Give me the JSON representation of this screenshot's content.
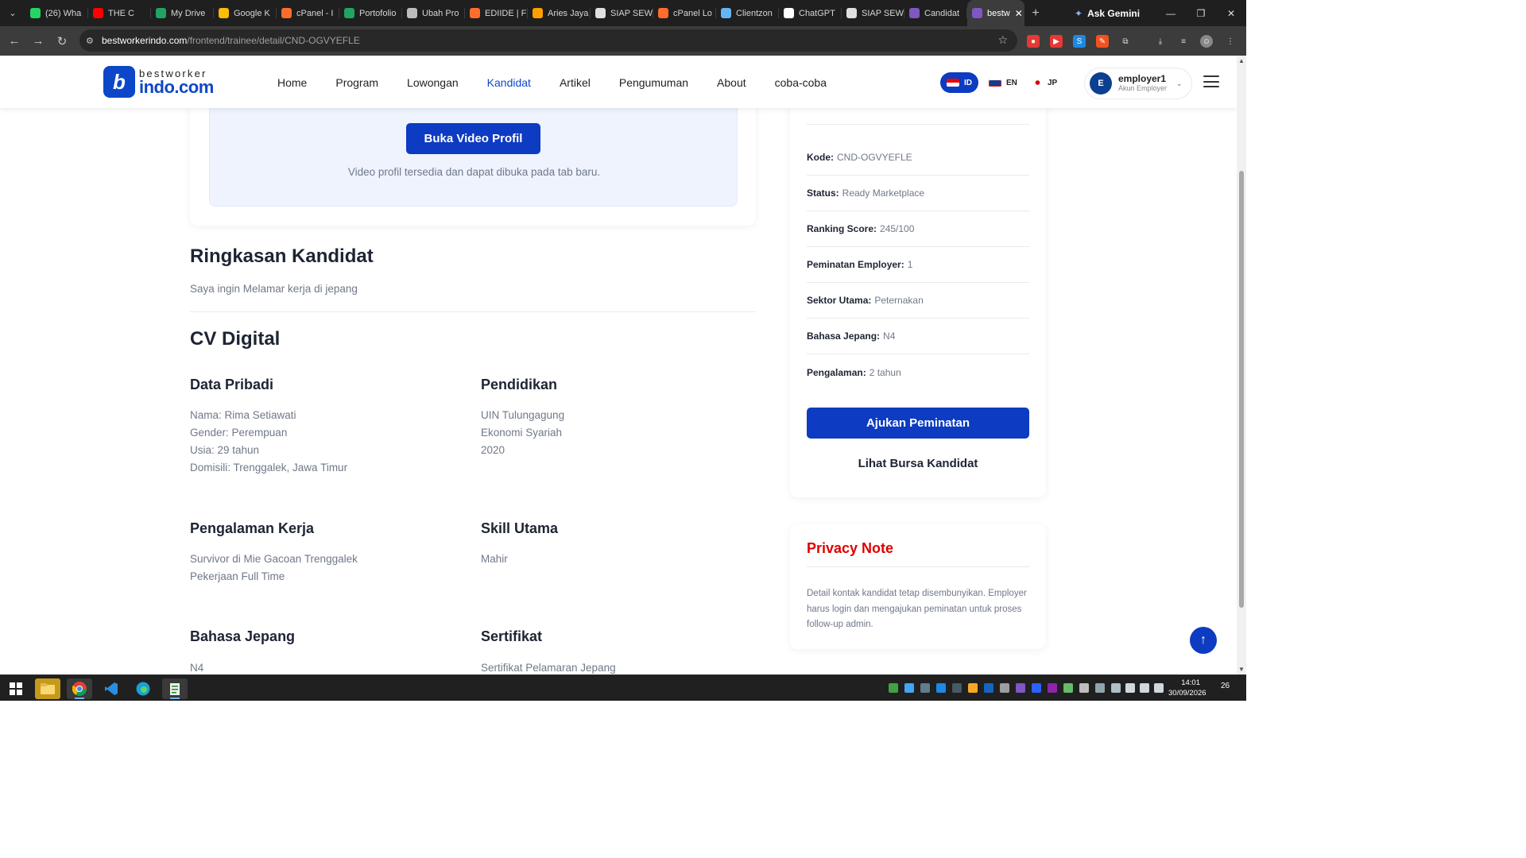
{
  "browser": {
    "tabs": [
      {
        "label": "(26) Wha",
        "color": "#25d366",
        "badge": "26"
      },
      {
        "label": "THE C",
        "color": "#ff0000"
      },
      {
        "label": "My Drive",
        "color": "#1fa463"
      },
      {
        "label": "Google K",
        "color": "#fbbc04"
      },
      {
        "label": "cPanel - I",
        "color": "#ff6c2c"
      },
      {
        "label": "Portofolio",
        "color": "#1fa463"
      },
      {
        "label": "Ubah Pro",
        "color": "#bdbdbd"
      },
      {
        "label": "EDIIDE | F",
        "color": "#ff6c2c"
      },
      {
        "label": "Aries Jaya",
        "color": "#ffa000"
      },
      {
        "label": "SIAP SEW",
        "color": "#e0e0e0"
      },
      {
        "label": "cPanel Lo",
        "color": "#ff6c2c"
      },
      {
        "label": "Clientzon",
        "color": "#64b5f6"
      },
      {
        "label": "ChatGPT",
        "color": "#ffffff"
      },
      {
        "label": "SIAP SEW",
        "color": "#e0e0e0"
      },
      {
        "label": "Candidat",
        "color": "#7e57c2"
      }
    ],
    "active_tab": {
      "label": "bestw",
      "color": "#7e57c2"
    },
    "gemini_label": "Ask Gemini",
    "url_host": "bestworkerindo.com",
    "url_path": "/frontend/trainee/detail/CND-OGVYEFLE"
  },
  "site": {
    "logo_line1": "bestworker",
    "logo_line2": "indo.com",
    "logo_mark": "b",
    "menu": [
      "Home",
      "Program",
      "Lowongan",
      "Kandidat",
      "Artikel",
      "Pengumuman",
      "About",
      "coba-coba"
    ],
    "active_menu": "Kandidat",
    "languages": [
      {
        "code": "ID",
        "active": true
      },
      {
        "code": "EN",
        "active": false
      },
      {
        "code": "JP",
        "active": false
      }
    ],
    "account": {
      "initial": "E",
      "name": "employer1",
      "role": "Akun Employer"
    }
  },
  "video": {
    "button": "Buka Video Profil",
    "hint": "Video profil tersedia dan dapat dibuka pada tab baru."
  },
  "summary": {
    "title": "Ringkasan Kandidat",
    "text": "Saya ingin Melamar kerja di jepang"
  },
  "cv": {
    "title": "CV Digital",
    "personal": {
      "title": "Data Pribadi",
      "lines": [
        "Nama: Rima Setiawati",
        "Gender: Perempuan",
        "Usia: 29 tahun",
        "Domisili: Trenggalek, Jawa Timur"
      ]
    },
    "education": {
      "title": "Pendidikan",
      "lines": [
        "UIN Tulungagung",
        "Ekonomi Syariah",
        "2020"
      ]
    },
    "experience": {
      "title": "Pengalaman Kerja",
      "lines": [
        "Survivor di Mie Gacoan Trenggalek",
        "Pekerjaan Full Time"
      ]
    },
    "skill": {
      "title": "Skill Utama",
      "lines": [
        "Mahir"
      ]
    },
    "japanese": {
      "title": "Bahasa Jepang",
      "lines": [
        "N4"
      ]
    },
    "certificate": {
      "title": "Sertifikat",
      "lines": [
        "Sertifikat Pelamaran Jepang"
      ]
    }
  },
  "sidebar": {
    "details": [
      {
        "label": "Kode:",
        "value": "CND-OGVYEFLE"
      },
      {
        "label": "Status:",
        "value": "Ready Marketplace"
      },
      {
        "label": "Ranking Score:",
        "value": "245/100"
      },
      {
        "label": "Peminatan Employer:",
        "value": "1"
      },
      {
        "label": "Sektor Utama:",
        "value": "Peternakan"
      },
      {
        "label": "Bahasa Jepang:",
        "value": "N4"
      },
      {
        "label": "Pengalaman:",
        "value": "2 tahun"
      }
    ],
    "apply_button": "Ajukan Peminatan",
    "browse_link": "Lihat Bursa Kandidat"
  },
  "privacy": {
    "title": "Privacy Note",
    "text": "Detail kontak kandidat tetap disembunyikan. Employer harus login dan mengajukan peminatan untuk proses follow-up admin."
  },
  "taskbar": {
    "time": "14:01",
    "date": "30/09/2026",
    "notification_count": "26"
  },
  "colors": {
    "brand_blue": "#0d3bc1",
    "privacy_red": "#e00000"
  }
}
